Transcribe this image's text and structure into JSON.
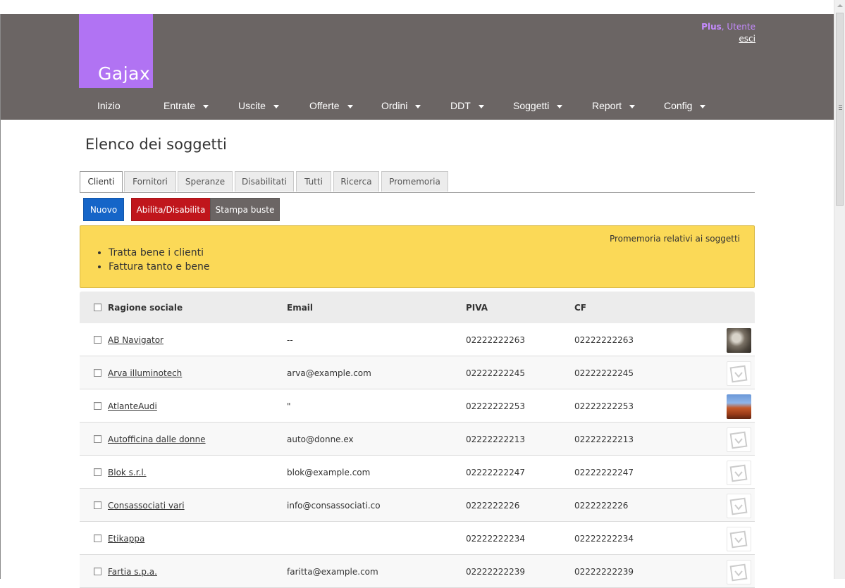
{
  "app": {
    "logo_text": "Gajax"
  },
  "user": {
    "plan": "Plus",
    "separator": ",",
    "name": "Utente",
    "logout_label": "esci"
  },
  "nav": {
    "items": [
      {
        "label": "Inizio",
        "dropdown": false
      },
      {
        "label": "Entrate",
        "dropdown": true
      },
      {
        "label": "Uscite",
        "dropdown": true
      },
      {
        "label": "Offerte",
        "dropdown": true
      },
      {
        "label": "Ordini",
        "dropdown": true
      },
      {
        "label": "DDT",
        "dropdown": true
      },
      {
        "label": "Soggetti",
        "dropdown": true
      },
      {
        "label": "Report",
        "dropdown": true
      },
      {
        "label": "Config",
        "dropdown": true
      }
    ]
  },
  "page": {
    "title": "Elenco dei soggetti"
  },
  "tabs": [
    {
      "label": "Clienti",
      "active": true
    },
    {
      "label": "Fornitori",
      "active": false
    },
    {
      "label": "Speranze",
      "active": false
    },
    {
      "label": "Disabilitati",
      "active": false
    },
    {
      "label": "Tutti",
      "active": false
    },
    {
      "label": "Ricerca",
      "active": false
    },
    {
      "label": "Promemoria",
      "active": false
    }
  ],
  "actions": {
    "new_label": "Nuovo",
    "toggle_label": "Abilita/Disabilita",
    "print_label": "Stampa buste"
  },
  "reminder": {
    "title": "Promemoria relativi ai soggetti",
    "items": [
      "Tratta bene i clienti",
      "Fattura tanto e bene"
    ]
  },
  "table": {
    "headers": {
      "name": "Ragione sociale",
      "email": "Email",
      "piva": "PIVA",
      "cf": "CF"
    },
    "rows": [
      {
        "name": "AB Navigator",
        "email": "--",
        "piva": "02222222263",
        "cf": "02222222263",
        "image": "koala-photo"
      },
      {
        "name": "Arva illuminotech",
        "email": "arva@example.com",
        "piva": "02222222245",
        "cf": "02222222245",
        "image": "placeholder"
      },
      {
        "name": "AtlanteAudi",
        "email": "\"",
        "piva": "02222222253",
        "cf": "02222222253",
        "image": "desert-photo"
      },
      {
        "name": "Autofficina dalle donne",
        "email": "auto@donne.ex",
        "piva": "02222222213",
        "cf": "02222222213",
        "image": "placeholder"
      },
      {
        "name": "Blok s.r.l.",
        "email": "blok@example.com",
        "piva": "02222222247",
        "cf": "02222222247",
        "image": "placeholder"
      },
      {
        "name": "Consassociati vari",
        "email": "info@consassociati.co",
        "piva": "0222222226",
        "cf": "0222222226",
        "image": "placeholder"
      },
      {
        "name": "Etikappa",
        "email": "",
        "piva": "02222222234",
        "cf": "02222222234",
        "image": "placeholder"
      },
      {
        "name": "Fartia s.p.a.",
        "email": "faritta@example.com",
        "piva": "02222222239",
        "cf": "02222222239",
        "image": "placeholder"
      }
    ]
  },
  "colors": {
    "header_bg": "#6b6564",
    "logo_bg": "#b173f3",
    "primary_button": "#1565c8",
    "danger_button": "#c0161c",
    "reminder_bg": "#fbd957"
  }
}
